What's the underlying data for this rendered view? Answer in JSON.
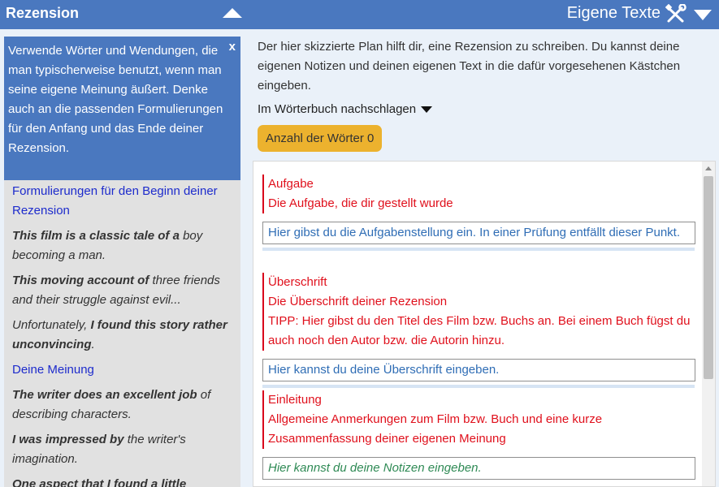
{
  "left_header": {
    "title": "Rezension"
  },
  "right_header": {
    "title": "Eigene Texte"
  },
  "tip": {
    "text": "Verwende Wörter und Wendungen, die man typischerweise benutzt, wenn man seine eigene Meinung äußert. Denke auch an die passenden Formulierungen für den Anfang und das Ende deiner Rezension.",
    "close_label": "x"
  },
  "sidebar": {
    "link_beginning": "Formulierungen für den Beginn deiner Rezension",
    "phrase1_bold": "This film is a classic tale of a",
    "phrase1_rest": " boy becoming a man.",
    "phrase2_bold": "This moving account of",
    "phrase2_rest": " three friends and their struggle against evil...",
    "phrase3_start": "Unfortunately, ",
    "phrase3_bold": "I found this story rather unconvincing",
    "phrase3_end": ".",
    "link_opinion": "Deine Meinung",
    "phrase4_bold1": "The writer does",
    "phrase4_bold2": " an excellent job",
    "phrase4_rest": " of describing characters.",
    "phrase5_bold": "I was impressed by",
    "phrase5_rest": " the writer's imagination.",
    "phrase6_bold": "One aspect that I found a little"
  },
  "main": {
    "intro": "Der hier skizzierte Plan hilft dir, eine Rezension zu schreiben. Du kannst deine eigenen Notizen und deinen eigenen Text in die dafür vorgesehenen Kästchen eingeben.",
    "lookup": "Im Wörterbuch nachschlagen",
    "count_label": "Anzahl der Wörter 0"
  },
  "sections": [
    {
      "title": "Aufgabe",
      "desc": "Die Aufgabe, die dir gestellt wurde",
      "input": "Hier gibst du die Aufgabenstellung ein. In einer Prüfung entfällt dieser Punkt."
    },
    {
      "title": "Überschrift",
      "desc": "Die Überschrift deiner Rezension",
      "tip": "TIPP: Hier gibst du den Titel des Film bzw. Buchs an. Bei einem Buch fügst du auch noch den Autor bzw. die Autorin hinzu.",
      "input": "Hier kannst du deine Überschrift eingeben."
    },
    {
      "title": "Einleitung",
      "desc": "Allgemeine Anmerkungen zum Film bzw. Buch und eine kurze Zusammenfassung deiner eigenen Meinung",
      "input": "Hier kannst du deine Notizen eingeben."
    }
  ]
}
